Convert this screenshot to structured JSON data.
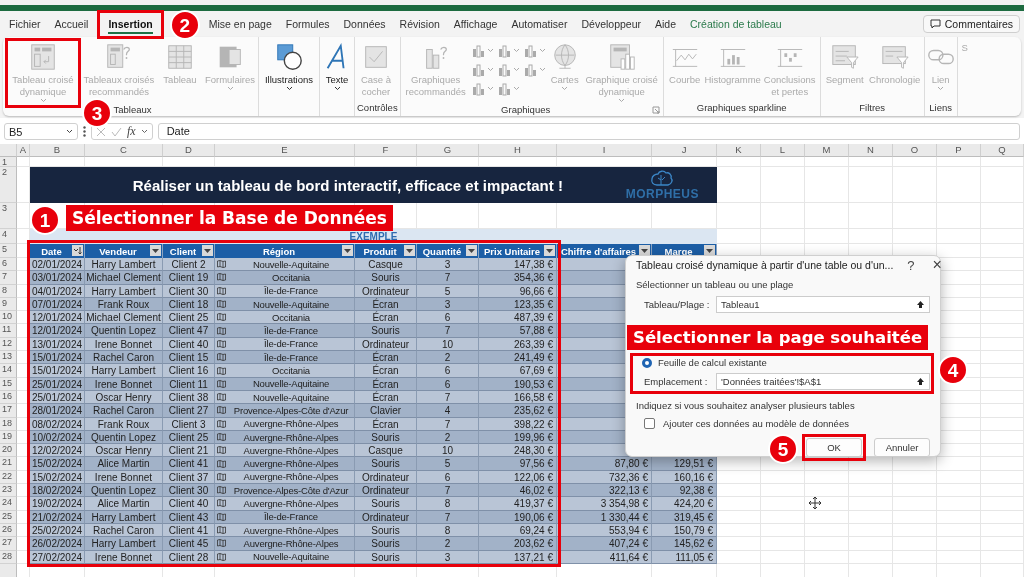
{
  "ribbon_tabs": [
    {
      "label": "Fichier",
      "selected": false,
      "kind": "normal"
    },
    {
      "label": "Accueil",
      "selected": false,
      "kind": "normal"
    },
    {
      "label": "Insertion",
      "selected": true,
      "kind": "normal"
    },
    {
      "label": "Mise en page",
      "selected": false,
      "kind": "normal"
    },
    {
      "label": "Formules",
      "selected": false,
      "kind": "normal"
    },
    {
      "label": "Données",
      "selected": false,
      "kind": "normal"
    },
    {
      "label": "Révision",
      "selected": false,
      "kind": "normal"
    },
    {
      "label": "Affichage",
      "selected": false,
      "kind": "normal"
    },
    {
      "label": "Automatiser",
      "selected": false,
      "kind": "normal"
    },
    {
      "label": "Développeur",
      "selected": false,
      "kind": "normal"
    },
    {
      "label": "Aide",
      "selected": false,
      "kind": "normal"
    },
    {
      "label": "Création de tableau",
      "selected": false,
      "kind": "contextual"
    }
  ],
  "comments_button": {
    "label": "Commentaires"
  },
  "ribbon_groups": [
    {
      "label": "Tableaux",
      "items": [
        {
          "kind": "large",
          "label": "Tableau croisé dynamique",
          "disabled": true,
          "dropdown": true
        },
        {
          "kind": "large",
          "label": "Tableaux croisés recommandés",
          "disabled": true,
          "dropdown": false
        },
        {
          "kind": "large",
          "label": "Tableau",
          "disabled": true,
          "dropdown": false
        },
        {
          "kind": "large",
          "label": "Formulaires",
          "disabled": true,
          "dropdown": true
        }
      ]
    },
    {
      "items": [
        {
          "kind": "large",
          "label": "Illustrations",
          "disabled": false,
          "dropdown": true
        }
      ]
    },
    {
      "items": [
        {
          "kind": "large",
          "label": "Texte",
          "disabled": false,
          "dropdown": true
        }
      ]
    },
    {
      "label": "Contrôles",
      "items": [
        {
          "kind": "large",
          "label": "Case à cocher",
          "disabled": true,
          "dropdown": false
        }
      ]
    },
    {
      "label": "Graphiques",
      "launcher": true,
      "items": [
        {
          "kind": "large",
          "label": "Graphiques recommandés",
          "disabled": true,
          "dropdown": false
        },
        {
          "kind": "small",
          "disabled": true,
          "dropdown": true
        },
        {
          "kind": "small",
          "disabled": true,
          "dropdown": true
        },
        {
          "kind": "small",
          "disabled": true,
          "dropdown": true
        },
        {
          "kind": "small",
          "disabled": true,
          "dropdown": true
        },
        {
          "kind": "small",
          "disabled": true,
          "dropdown": true
        },
        {
          "kind": "small",
          "disabled": true,
          "dropdown": true
        },
        {
          "kind": "small",
          "disabled": true,
          "dropdown": true
        },
        {
          "kind": "small",
          "disabled": true,
          "dropdown": true
        },
        {
          "kind": "large",
          "label": "Cartes",
          "disabled": true,
          "dropdown": true
        },
        {
          "kind": "large",
          "label": "Graphique croisé dynamique",
          "disabled": true,
          "dropdown": true
        }
      ]
    },
    {
      "label": "Graphiques sparkline",
      "items": [
        {
          "kind": "large",
          "label": "Courbe",
          "disabled": true,
          "dropdown": false
        },
        {
          "kind": "large",
          "label": "Histogramme",
          "disabled": true,
          "dropdown": false
        },
        {
          "kind": "large",
          "label": "Conclusions et pertes",
          "disabled": true,
          "dropdown": false
        }
      ]
    },
    {
      "label": "Filtres",
      "items": [
        {
          "kind": "large",
          "label": "Segment",
          "disabled": true,
          "dropdown": false
        },
        {
          "kind": "large",
          "label": "Chronologie",
          "disabled": true,
          "dropdown": false
        }
      ]
    },
    {
      "label": "Liens",
      "items": [
        {
          "kind": "large",
          "label": "Lien",
          "disabled": true,
          "dropdown": true
        }
      ]
    },
    {
      "items": [
        {
          "kind": "large",
          "label": "S",
          "disabled": true,
          "dropdown": false
        }
      ]
    }
  ],
  "formula_bar": {
    "name_box": "B5",
    "function_label": "fx",
    "formula": "Date"
  },
  "sheet": {
    "column_headers": [
      "A",
      "B",
      "C",
      "D",
      "E",
      "F",
      "G",
      "H",
      "I",
      "J",
      "K",
      "L",
      "M",
      "N",
      "O",
      "P",
      "Q"
    ],
    "row_numbers": [
      "1",
      "2",
      "3",
      "4",
      "5",
      "6",
      "7",
      "8",
      "9",
      "10",
      "11",
      "12",
      "13",
      "14",
      "15",
      "16",
      "17",
      "18",
      "19",
      "20",
      "21",
      "22",
      "23",
      "24",
      "25",
      "26",
      "27",
      "28"
    ],
    "banner_title": "Réaliser un tableau de bord interactif, efficace et impactant !",
    "logo_text": "MORPHEUS",
    "section_label": "EXEMPLE",
    "table": {
      "columns": [
        {
          "label": "Date",
          "sorted": true
        },
        {
          "label": "Vendeur",
          "sorted": false
        },
        {
          "label": "Client",
          "sorted": false
        },
        {
          "label": "Région",
          "sorted": false
        },
        {
          "label": "Produit",
          "sorted": false
        },
        {
          "label": "Quantité",
          "sorted": false
        },
        {
          "label": "Prix Unitaire",
          "sorted": false
        },
        {
          "label": "Chiffre d'affaires",
          "sorted": false
        },
        {
          "label": "Marge",
          "sorted": false
        }
      ],
      "rows": [
        [
          "02/01/2024",
          "Harry Lambert",
          "Client 2",
          "Nouvelle-Aquitaine",
          "Casque",
          "3",
          "147,38 €"
        ],
        [
          "03/01/2024",
          "Michael Clement",
          "Client 19",
          "Occitania",
          "Souris",
          "7",
          "354,36 €"
        ],
        [
          "04/01/2024",
          "Harry Lambert",
          "Client 30",
          "Île-de-France",
          "Ordinateur",
          "5",
          "96,66 €"
        ],
        [
          "07/01/2024",
          "Frank Roux",
          "Client 18",
          "Nouvelle-Aquitaine",
          "Écran",
          "3",
          "123,35 €"
        ],
        [
          "12/01/2024",
          "Michael Clement",
          "Client 25",
          "Occitania",
          "Écran",
          "6",
          "487,39 €"
        ],
        [
          "12/01/2024",
          "Quentin Lopez",
          "Client 47",
          "Île-de-France",
          "Souris",
          "7",
          "57,88 €"
        ],
        [
          "13/01/2024",
          "Irene Bonnet",
          "Client 40",
          "Île-de-France",
          "Ordinateur",
          "10",
          "263,39 €"
        ],
        [
          "15/01/2024",
          "Rachel Caron",
          "Client 15",
          "Île-de-France",
          "Écran",
          "2",
          "241,49 €"
        ],
        [
          "15/01/2024",
          "Harry Lambert",
          "Client 16",
          "Occitania",
          "Écran",
          "6",
          "67,69 €"
        ],
        [
          "25/01/2024",
          "Irene Bonnet",
          "Client 11",
          "Nouvelle-Aquitaine",
          "Écran",
          "6",
          "190,53 €"
        ],
        [
          "25/01/2024",
          "Oscar Henry",
          "Client 38",
          "Nouvelle-Aquitaine",
          "Écran",
          "7",
          "166,58 €"
        ],
        [
          "28/01/2024",
          "Rachel Caron",
          "Client 27",
          "Provence-Alpes-Côte d'Azur",
          "Clavier",
          "4",
          "235,62 €"
        ],
        [
          "08/02/2024",
          "Frank Roux",
          "Client 3",
          "Auvergne-Rhône-Alpes",
          "Écran",
          "7",
          "398,22 €"
        ],
        [
          "10/02/2024",
          "Quentin Lopez",
          "Client 25",
          "Auvergne-Rhône-Alpes",
          "Souris",
          "2",
          "199,96 €"
        ],
        [
          "12/02/2024",
          "Oscar Henry",
          "Client 21",
          "Auvergne-Rhône-Alpes",
          "Casque",
          "10",
          "248,30 €"
        ],
        [
          "15/02/2024",
          "Alice Martin",
          "Client 41",
          "Auvergne-Rhône-Alpes",
          "Souris",
          "5",
          "97,56 €",
          "87,80 €",
          "129,51 €"
        ],
        [
          "15/02/2024",
          "Irene Bonnet",
          "Client 37",
          "Auvergne-Rhône-Alpes",
          "Ordinateur",
          "6",
          "122,06 €",
          "732,36 €",
          "160,16 €"
        ],
        [
          "18/02/2024",
          "Quentin Lopez",
          "Client 30",
          "Provence-Alpes-Côte d'Azur",
          "Ordinateur",
          "7",
          "46,02 €",
          "322,13 €",
          "92,38 €"
        ],
        [
          "19/02/2024",
          "Alice Martin",
          "Client 40",
          "Auvergne-Rhône-Alpes",
          "Souris",
          "8",
          "419,37 €",
          "3 354,98 €",
          "424,20 €"
        ],
        [
          "21/02/2024",
          "Harry Lambert",
          "Client 43",
          "Île-de-France",
          "Ordinateur",
          "7",
          "190,06 €",
          "1 330,44 €",
          "319,45 €"
        ],
        [
          "25/02/2024",
          "Rachel Caron",
          "Client 41",
          "Auvergne-Rhône-Alpes",
          "Souris",
          "8",
          "69,24 €",
          "553,94 €",
          "150,79 €"
        ],
        [
          "26/02/2024",
          "Harry Lambert",
          "Client 45",
          "Auvergne-Rhône-Alpes",
          "Souris",
          "2",
          "203,62 €",
          "407,24 €",
          "145,62 €"
        ],
        [
          "27/02/2024",
          "Irene Bonnet",
          "Client 28",
          "Nouvelle-Aquitaine",
          "Souris",
          "3",
          "137,21 €",
          "411,64 €",
          "111,05 €"
        ]
      ]
    }
  },
  "dialog": {
    "title": "Tableau croisé dynamique à partir d'une table ou d'un...",
    "help": "?",
    "close": "×",
    "source_heading": "Sélectionner un tableau ou une plage",
    "range_label": "Tableau/Plage :",
    "range_value": "Tableau1",
    "location": {
      "label": "Feuille de calcul existante",
      "checked": true
    },
    "location_label": "Emplacement :",
    "location_value": "'Données traitées'!$A$1",
    "multi_heading": "Indiquez si vous souhaitez analyser plusieurs tables",
    "data_model": {
      "label": "Ajouter ces données au modèle de données",
      "checked": false
    },
    "ok": "OK",
    "cancel": "Annuler"
  },
  "callouts": [
    {
      "number": "1",
      "label": "Sélectionner la Base de Données"
    },
    {
      "number": "2"
    },
    {
      "number": "3"
    },
    {
      "number": "4",
      "label": "Sélectionner la page souhaitée"
    },
    {
      "number": "5"
    }
  ]
}
